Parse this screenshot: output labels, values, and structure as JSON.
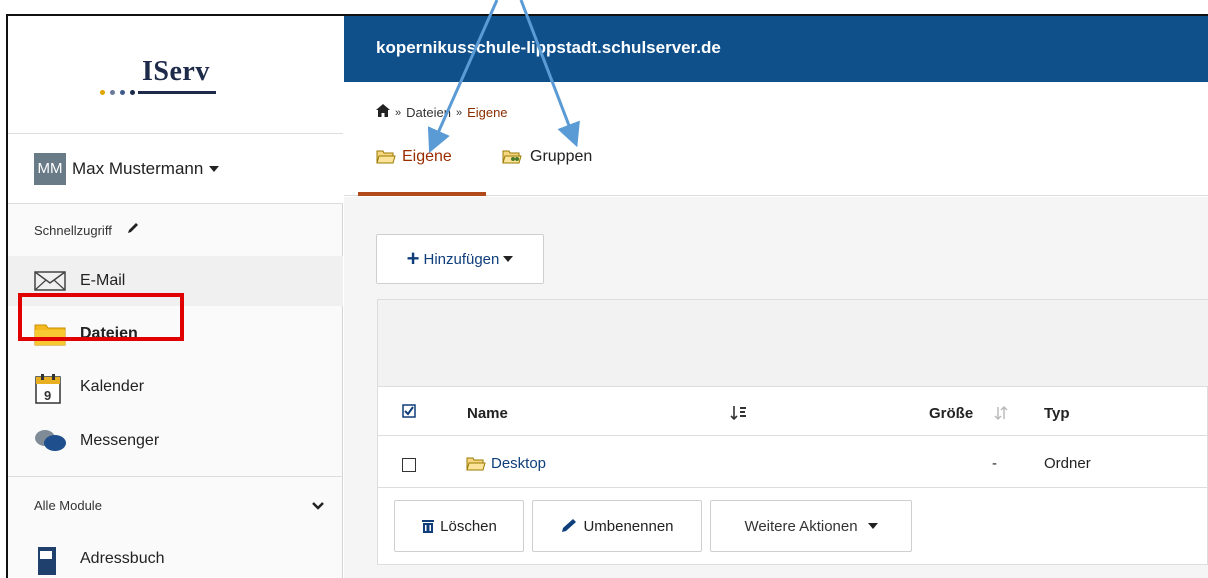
{
  "header": {
    "domain": "kopernikusschule-lippstadt.schulserver.de"
  },
  "logo": {
    "text": "IServ"
  },
  "user": {
    "initials": "MM",
    "name": "Max Mustermann"
  },
  "sidebar": {
    "quick_access_label": "Schnellzugriff",
    "items": [
      {
        "label": "E-Mail",
        "icon": "envelope-icon"
      },
      {
        "label": "Dateien",
        "icon": "folder-icon"
      },
      {
        "label": "Kalender",
        "icon": "calendar-icon",
        "day": "9"
      },
      {
        "label": "Messenger",
        "icon": "chat-bubbles-icon"
      }
    ],
    "all_modules_label": "Alle Module",
    "modules": [
      {
        "label": "Adressbuch",
        "icon": "address-book-icon"
      }
    ]
  },
  "breadcrumb": {
    "items": [
      "Dateien",
      "Eigene"
    ]
  },
  "tabs": [
    {
      "label": "Eigene",
      "active": true
    },
    {
      "label": "Gruppen",
      "active": false
    }
  ],
  "toolbar": {
    "add_label": "Hinzufügen"
  },
  "table": {
    "columns": {
      "name": "Name",
      "size": "Größe",
      "type": "Typ"
    },
    "rows": [
      {
        "name": "Desktop",
        "size": "-",
        "type": "Ordner"
      }
    ]
  },
  "actions": {
    "delete_label": "Löschen",
    "rename_label": "Umbenennen",
    "more_label": "Weitere Aktionen"
  },
  "colors": {
    "header_blue": "#0f4f8a",
    "active_tab": "#9a2d00",
    "highlight_red": "#e00000",
    "annotation_arrow": "#5b9bd5"
  }
}
